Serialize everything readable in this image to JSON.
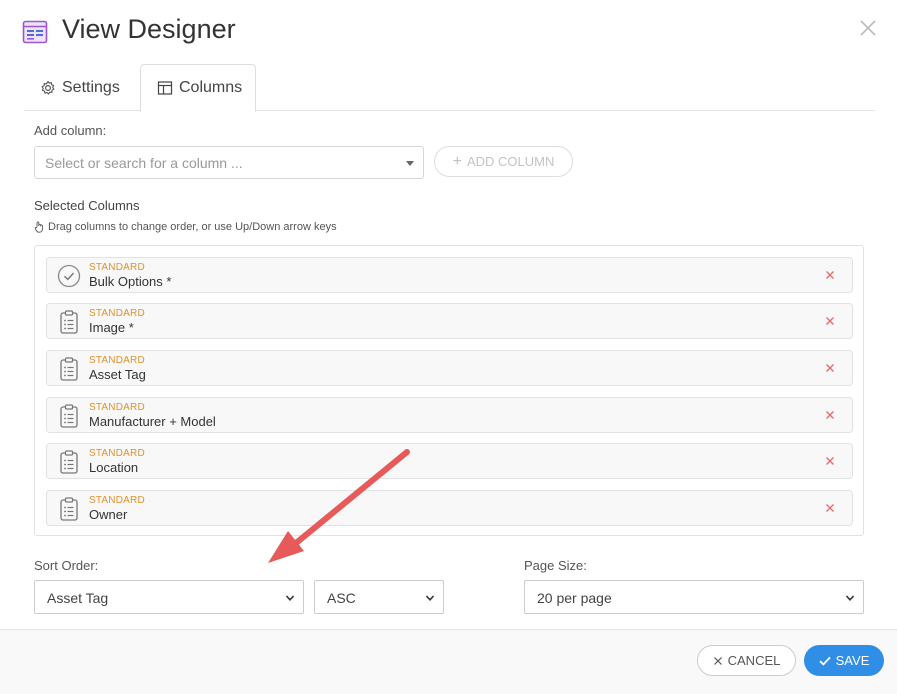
{
  "dialog": {
    "title": "View Designer"
  },
  "tabs": [
    {
      "label": "Settings",
      "icon": "gear-icon",
      "active": false
    },
    {
      "label": "Columns",
      "icon": "table-icon",
      "active": true
    }
  ],
  "add_column": {
    "label": "Add column:",
    "placeholder": "Select or search for a column ...",
    "button_label": "ADD COLUMN"
  },
  "selected_columns": {
    "label": "Selected Columns",
    "hint": "Drag columns to change order, or use Up/Down arrow keys",
    "items": [
      {
        "kind": "STANDARD",
        "name": "Bulk Options *",
        "icon": "check-circle-icon"
      },
      {
        "kind": "STANDARD",
        "name": "Image *",
        "icon": "clipboard-list-icon"
      },
      {
        "kind": "STANDARD",
        "name": "Asset Tag",
        "icon": "clipboard-list-icon"
      },
      {
        "kind": "STANDARD",
        "name": "Manufacturer + Model",
        "icon": "clipboard-list-icon"
      },
      {
        "kind": "STANDARD",
        "name": "Location",
        "icon": "clipboard-list-icon"
      },
      {
        "kind": "STANDARD",
        "name": "Owner",
        "icon": "clipboard-list-icon"
      }
    ]
  },
  "sort": {
    "label": "Sort Order:",
    "field": "Asset Tag",
    "direction": "ASC"
  },
  "page_size": {
    "label": "Page Size:",
    "value": "20 per page"
  },
  "footer": {
    "cancel_label": "CANCEL",
    "save_label": "SAVE"
  },
  "colors": {
    "accent": "#2f8fe6",
    "kind_label": "#e0922b",
    "remove": "#e86a6a",
    "annotation_arrow": "#e65a5a",
    "header_icon": "#9b59d0"
  }
}
